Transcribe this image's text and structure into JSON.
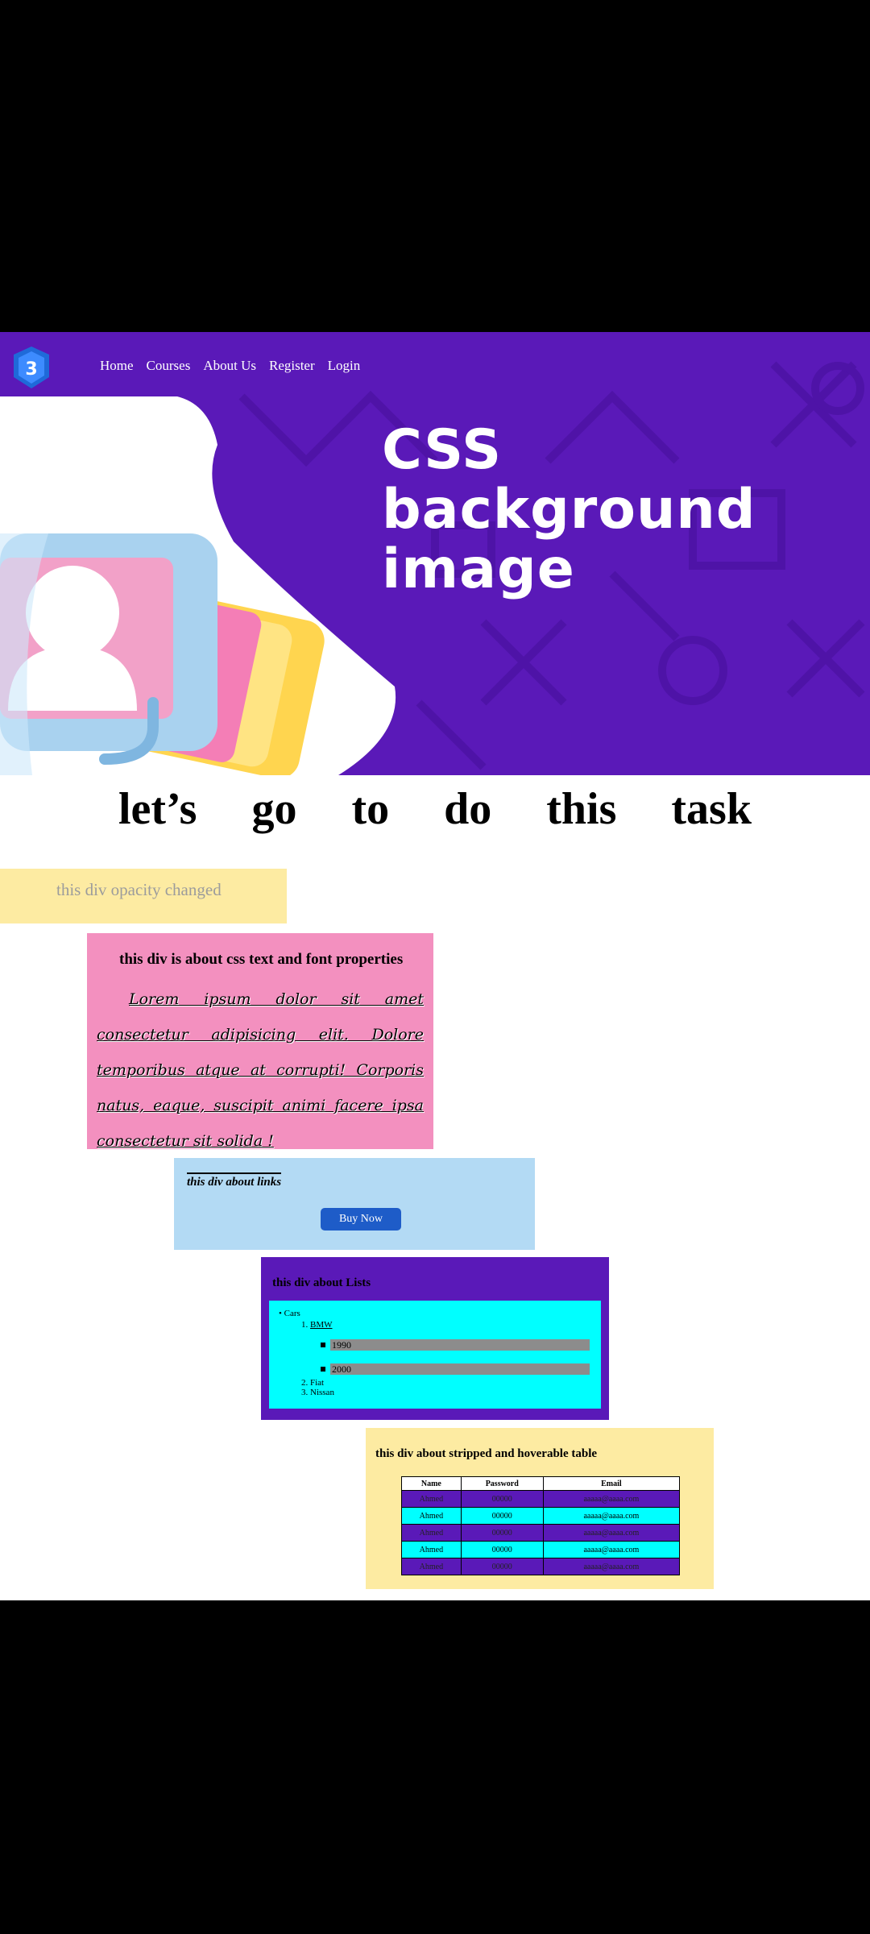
{
  "nav": {
    "items": [
      "Home",
      "Courses",
      "About Us",
      "Register",
      "Login"
    ]
  },
  "hero": {
    "title_lines": [
      "CSS",
      "background",
      "image"
    ]
  },
  "task_words": [
    "let’s",
    "go",
    "to",
    "do",
    "this",
    "task"
  ],
  "opacity_div": {
    "text": "this div opacity changed"
  },
  "text_div": {
    "heading": "this div is about css text and font properties",
    "paragraph": "Lorem ipsum dolor sit amet consectetur adipisicing elit. Dolore temporibus atque at corrupti! Corporis natus, eaque, suscipit animi facere ipsa consectetur sit solida !"
  },
  "links_div": {
    "heading": "this div about links",
    "button_label": "Buy Now"
  },
  "lists_div": {
    "heading": "this div about Lists",
    "top_item": "Cars",
    "ordered": [
      "BMW",
      "Fiat",
      "Nissan"
    ],
    "nested": [
      "1990",
      "2000"
    ]
  },
  "table_div": {
    "heading": "this div about stripped and hoverable table",
    "headers": [
      "Name",
      "Password",
      "Email"
    ],
    "rows": [
      [
        "Ahmed",
        "00000",
        "aaaaa@aaaa.com"
      ],
      [
        "Ahmed",
        "00000",
        "aaaaa@aaaa.com"
      ],
      [
        "Ahmed",
        "00000",
        "aaaaa@aaaa.com"
      ],
      [
        "Ahmed",
        "00000",
        "aaaaa@aaaa.com"
      ],
      [
        "Ahmed",
        "00000",
        "aaaaa@aaaa.com"
      ]
    ]
  },
  "colors": {
    "purple": "#5a19b8",
    "cyan": "#00ffff",
    "pink": "#f390bf",
    "yellow": "#fdeba2",
    "blue": "#b3daf4"
  }
}
